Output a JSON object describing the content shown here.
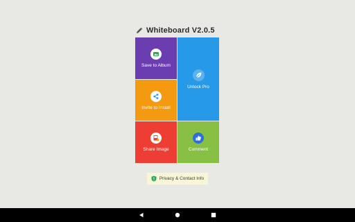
{
  "app": {
    "title": "Whiteboard V2.0.5"
  },
  "tiles": {
    "save": {
      "label": "Save to Album",
      "icon": "album-icon",
      "color": "#6a3db0"
    },
    "invite": {
      "label": "Invite to Install",
      "icon": "share-icon",
      "color": "#f39a11"
    },
    "unlock": {
      "label": "Unlock Pro",
      "icon": "leaf-icon",
      "color": "#2699e8"
    },
    "share": {
      "label": "Share Image",
      "icon": "image-icon",
      "color": "#ee3d32"
    },
    "comment": {
      "label": "Comment",
      "icon": "thumbs-up-icon",
      "color": "#88bf45"
    }
  },
  "privacy": {
    "label": "Privacy & Contact Info",
    "icon": "shield-icon"
  },
  "navigation": {
    "back": "back-icon",
    "home": "home-icon",
    "recents": "recents-icon"
  }
}
